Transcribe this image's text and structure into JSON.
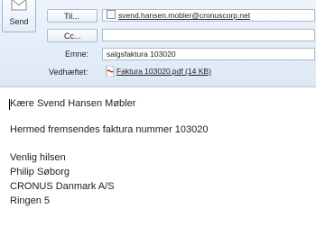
{
  "toolbar": {
    "send_label": "Send",
    "send_icon": "send-mail-icon"
  },
  "header": {
    "to_button_label": "Til...",
    "cc_button_label": "Cc...",
    "to_value": "svend.hansen.mobler@cronuscorp.net",
    "cc_value": "",
    "subject_label": "Emne:",
    "subject_value": "salgsfaktura 103020",
    "attached_label": "Vedhæftet:",
    "attachment_name": "Faktura 103020.pdf (14 KB)",
    "attachment_icon": "pdf-file-icon"
  },
  "body": {
    "lines": [
      "Kære Svend Hansen Møbler",
      "Hermed fremsendes faktura nummer 103020",
      "Venlig hilsen",
      "Philip Søborg",
      "CRONUS Danmark A/S",
      "Ringen 5"
    ]
  }
}
